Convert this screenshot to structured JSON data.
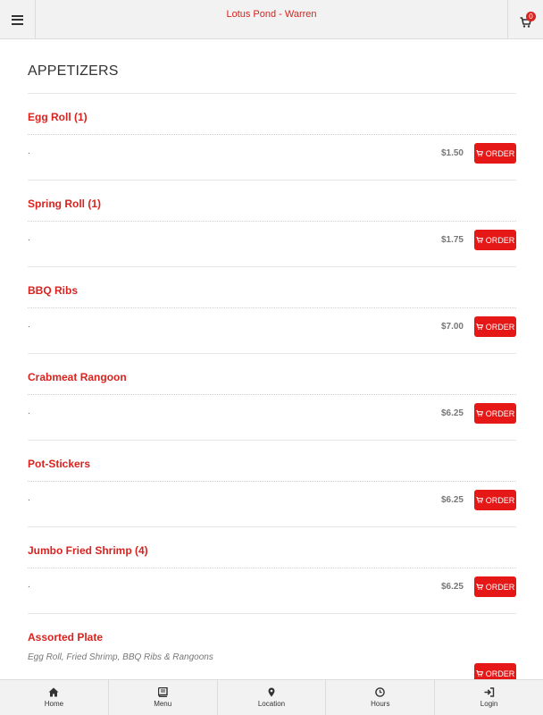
{
  "header": {
    "title": "Lotus Pond - Warren",
    "cart_count": "0",
    "menu_icon": "bars-icon",
    "cart_icon": "shopping-cart-icon"
  },
  "menu": {
    "section_title": "APPETIZERS",
    "items": [
      {
        "name": "Egg Roll (1)",
        "description": ".",
        "price": "$1.50",
        "order_label": "ORDER"
      },
      {
        "name": "Spring Roll (1)",
        "description": ".",
        "price": "$1.75",
        "order_label": "ORDER"
      },
      {
        "name": "BBQ Ribs",
        "description": ".",
        "price": "$7.00",
        "order_label": "ORDER"
      },
      {
        "name": "Crabmeat Rangoon",
        "description": ".",
        "price": "$6.25",
        "order_label": "ORDER"
      },
      {
        "name": "Pot-Stickers",
        "description": ".",
        "price": "$6.25",
        "order_label": "ORDER"
      },
      {
        "name": "Jumbo Fried Shrimp (4)",
        "description": ".",
        "price": "$6.25",
        "order_label": "ORDER"
      },
      {
        "name": "Assorted Plate",
        "description": "Egg Roll, Fried Shrimp, BBQ Ribs & Rangoons",
        "price": "",
        "order_label": "ORDER"
      }
    ]
  },
  "bottom_nav": [
    {
      "label": "Home",
      "icon": "home-icon"
    },
    {
      "label": "Menu",
      "icon": "book-icon"
    },
    {
      "label": "Location",
      "icon": "map-marker-icon"
    },
    {
      "label": "Hours",
      "icon": "clock-icon"
    },
    {
      "label": "Login",
      "icon": "sign-in-icon"
    }
  ],
  "colors": {
    "accent": "#d8231f",
    "button": "#e61717",
    "bar_background": "#f2f2f2"
  }
}
